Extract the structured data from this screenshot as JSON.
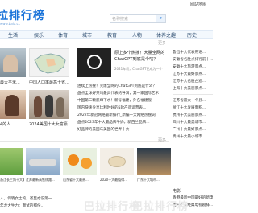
{
  "header": {
    "logo_text": "拉排行榜",
    "logo_sub": "www.bala.cc",
    "search_placeholder": "名称搜索",
    "search_icon": "search-icon",
    "link_home": "网站地图",
    "link_feedback": "反馈"
  },
  "nav": [
    "生活",
    "娱乐",
    "体育",
    "城市",
    "教育",
    "人物",
    "体养之趣",
    "历史"
  ],
  "feature": {
    "title_line1": "原上多个热搜！大量全网的",
    "title_line2": "ChatGPT到底是个啥？",
    "meta": "2021年初，ChatGPT已成为一个",
    "more": "更多"
  },
  "left_captions": [
    "最大平米...",
    "中国人口率最高十省...",
    "2024美国十大女富豪..."
  ],
  "left_lines": [
    "4的人",
    "乾坤一看..."
  ],
  "news": [
    "连续上热搜！火爆全网的ChatGPT到底是什么？",
    "盘点全球好莱坞最具代表的导演，其一家国际艺术",
    "中国第三颗航母下水！新号福建，外名福建舰",
    "国内快速分享比利时好的5款产品运营表...",
    "2022年新冠网络最新排行_新编十大网络热搜词",
    "盘点2023年十大最品牌牛奶，新西兰品牌...",
    "好品牌的美国与美国的世界十大"
  ],
  "right_top": [
    "鲁迅十大代表用语...",
    "安徽省名胜点排行前十...",
    "安徽十大旅游景点...",
    "江苏十大最好景点...",
    "江苏十大名胜古迹...",
    "上海十大美丽景点..."
  ],
  "right_mid": [
    "江苏省最大十个县...",
    "浙江十大发展面积...",
    "杭州十大美丽景点...",
    "四川十大最美城市...",
    "广州十大最好景点...",
    "贵州十大最小城市..."
  ],
  "section_titles": {
    "more": "更多",
    "right_bottom": "电影"
  },
  "bottom_captions": [
    "浙江长三角十大最...",
    "江苏最新高铁线路...",
    "山东省十大最贵...",
    "2020十大最值得...",
    "广东十大城市...",
    "湖南省周边..."
  ],
  "bottom_lines": [
    "人，何晓女士的，甚至亦说第一",
    "年龙大生力：面试的那份..."
  ],
  "right_bottom": [
    "香港最新中国最好的新电...",
    "国内十大经典电视剧排..."
  ],
  "watermark": "巴拉排行榜",
  "colors": {
    "brand": "#1a73d9"
  }
}
